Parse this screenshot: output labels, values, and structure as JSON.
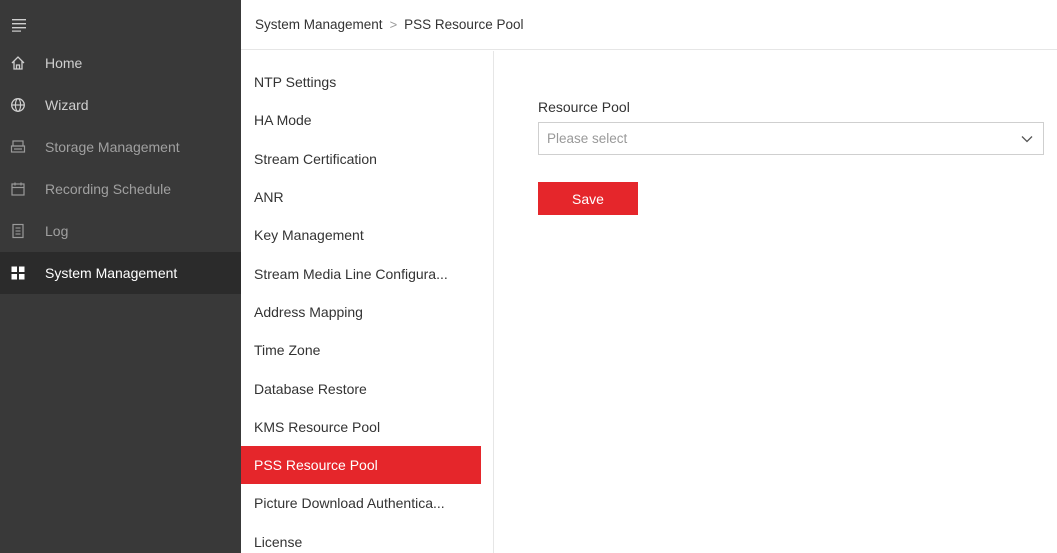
{
  "sidebar": {
    "items": [
      {
        "label": "Home",
        "icon": "home-icon"
      },
      {
        "label": "Wizard",
        "icon": "globe-icon"
      },
      {
        "label": "Storage Management",
        "icon": "storage-icon"
      },
      {
        "label": "Recording Schedule",
        "icon": "calendar-icon"
      },
      {
        "label": "Log",
        "icon": "document-icon"
      },
      {
        "label": "System Management",
        "icon": "grid-icon"
      }
    ]
  },
  "breadcrumb": {
    "parent": "System Management",
    "separator": ">",
    "current": "PSS Resource Pool"
  },
  "submenu": {
    "items": [
      "NTP Settings",
      "HA Mode",
      "Stream Certification",
      "ANR",
      "Key Management",
      "Stream Media Line Configura...",
      "Address Mapping",
      "Time Zone",
      "Database Restore",
      "KMS Resource Pool",
      "PSS Resource Pool",
      "Picture Download Authentica...",
      "License"
    ],
    "active": "PSS Resource Pool"
  },
  "form": {
    "resource_pool_label": "Resource Pool",
    "resource_pool_placeholder": "Please select",
    "save_label": "Save"
  },
  "colors": {
    "accent": "#e5262b",
    "sidebar_bg": "#393939",
    "sidebar_active_bg": "#2b2b2b"
  }
}
